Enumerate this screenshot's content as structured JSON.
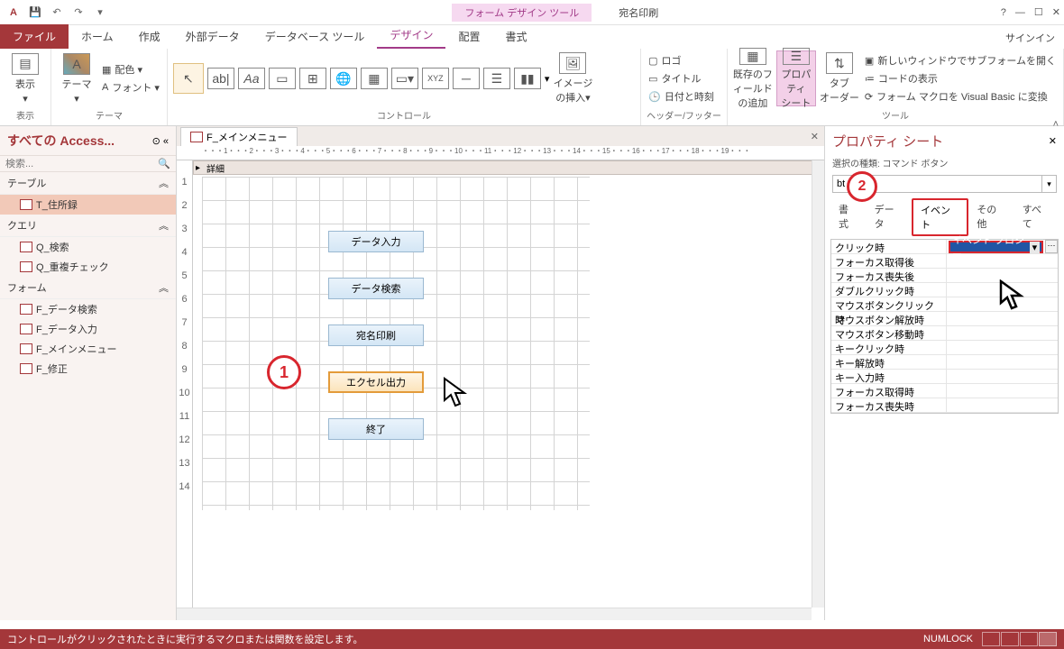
{
  "title": {
    "context": "フォーム デザイン ツール",
    "doc": "宛名印刷"
  },
  "qat": {
    "undo": "↶",
    "redo": "↷"
  },
  "win": {
    "help": "?",
    "min": "—",
    "max": "☐",
    "close": "✕",
    "signin": "サインイン"
  },
  "tabs": {
    "file": "ファイル",
    "home": "ホーム",
    "create": "作成",
    "external": "外部データ",
    "dbtools": "データベース ツール",
    "design": "デザイン",
    "arrange": "配置",
    "format": "書式"
  },
  "ribbon": {
    "views": {
      "label": "表示",
      "btn": "表示"
    },
    "themes": {
      "label": "テーマ",
      "btn": "テーマ",
      "colors": "配色 ▾",
      "fonts": "フォント ▾"
    },
    "controls": {
      "label": "コントロール",
      "insertimg": "イメージ\nの挿入▾"
    },
    "header": {
      "label": "ヘッダー/フッター",
      "logo": "ロゴ",
      "title": "タイトル",
      "datetime": "日付と時刻"
    },
    "tools": {
      "label": "ツール",
      "addfield": "既存のフィールド\nの追加",
      "propsheet": "プロパティ\nシート",
      "taborder": "タブ\nオーダー",
      "subform": "新しいウィンドウでサブフォームを開く",
      "showcode": "コードの表示",
      "convert": "フォーム マクロを Visual Basic に変換"
    }
  },
  "nav": {
    "title": "すべての Access...",
    "search_ph": "検索...",
    "groups": {
      "tables": "テーブル",
      "queries": "クエリ",
      "forms": "フォーム"
    },
    "tables": [
      "T_住所録"
    ],
    "queries": [
      "Q_検索",
      "Q_重複チェック"
    ],
    "forms": [
      "F_データ検索",
      "F_データ入力",
      "F_メインメニュー",
      "F_修正"
    ]
  },
  "doctab": "F_メインメニュー",
  "section": "詳細",
  "ruler_h": "・・・1・・・2・・・3・・・4・・・5・・・6・・・7・・・8・・・9・・・10・・・11・・・12・・・13・・・14・・・15・・・16・・・17・・・18・・・19・・・",
  "ruler_v": [
    "1",
    "2",
    "3",
    "4",
    "5",
    "6",
    "7",
    "8",
    "9",
    "10",
    "11",
    "12",
    "13",
    "14"
  ],
  "buttons": {
    "b1": "データ入力",
    "b2": "データ検索",
    "b3": "宛名印刷",
    "b4": "エクセル出力",
    "b5": "終了"
  },
  "callouts": {
    "c1": "1",
    "c2": "2"
  },
  "prop": {
    "title": "プロパティ シート",
    "sub": "選択の種類: コマンド ボタン",
    "combo": "bt",
    "close": "✕",
    "tabs": {
      "format": "書式",
      "data": "データ",
      "event": "イベント",
      "other": "その他",
      "all": "すべて"
    },
    "rows": [
      {
        "k": "クリック時",
        "v": "イベント プロシー",
        "sel": true
      },
      {
        "k": "フォーカス取得後",
        "v": ""
      },
      {
        "k": "フォーカス喪失後",
        "v": ""
      },
      {
        "k": "ダブルクリック時",
        "v": ""
      },
      {
        "k": "マウスボタンクリック時",
        "v": ""
      },
      {
        "k": "マウスボタン解放時",
        "v": ""
      },
      {
        "k": "マウスボタン移動時",
        "v": ""
      },
      {
        "k": "キークリック時",
        "v": ""
      },
      {
        "k": "キー解放時",
        "v": ""
      },
      {
        "k": "キー入力時",
        "v": ""
      },
      {
        "k": "フォーカス取得時",
        "v": ""
      },
      {
        "k": "フォーカス喪失時",
        "v": ""
      }
    ]
  },
  "status": {
    "msg": "コントロールがクリックされたときに実行するマクロまたは関数を設定します。",
    "numlock": "NUMLOCK"
  }
}
